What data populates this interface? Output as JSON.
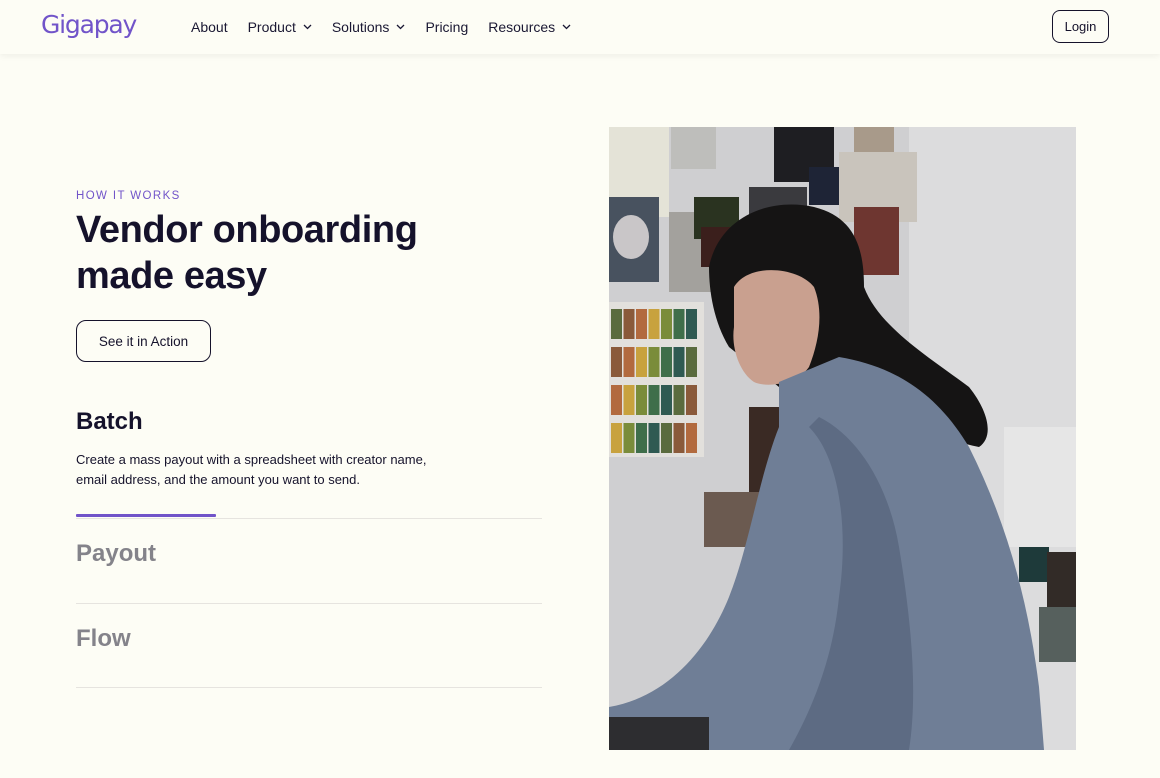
{
  "header": {
    "logo": "Gigapay",
    "nav": [
      {
        "label": "About",
        "has_dropdown": false
      },
      {
        "label": "Product",
        "has_dropdown": true
      },
      {
        "label": "Solutions",
        "has_dropdown": true
      },
      {
        "label": "Pricing",
        "has_dropdown": false
      },
      {
        "label": "Resources",
        "has_dropdown": true
      }
    ],
    "login_label": "Login"
  },
  "hero": {
    "eyebrow": "HOW IT WORKS",
    "headline": "Vendor onboarding made easy",
    "cta_label": "See it in Action"
  },
  "features": [
    {
      "title": "Batch",
      "description": "Create a mass payout with a spreadsheet with creator name, email address, and the amount you want to send.",
      "active": true,
      "progress_fraction": 0.3
    },
    {
      "title": "Payout",
      "active": false
    },
    {
      "title": "Flow",
      "active": false
    }
  ],
  "colors": {
    "accent": "#7154c9",
    "background": "#fdfdf5",
    "text": "#15122b",
    "muted": "#84838a"
  }
}
